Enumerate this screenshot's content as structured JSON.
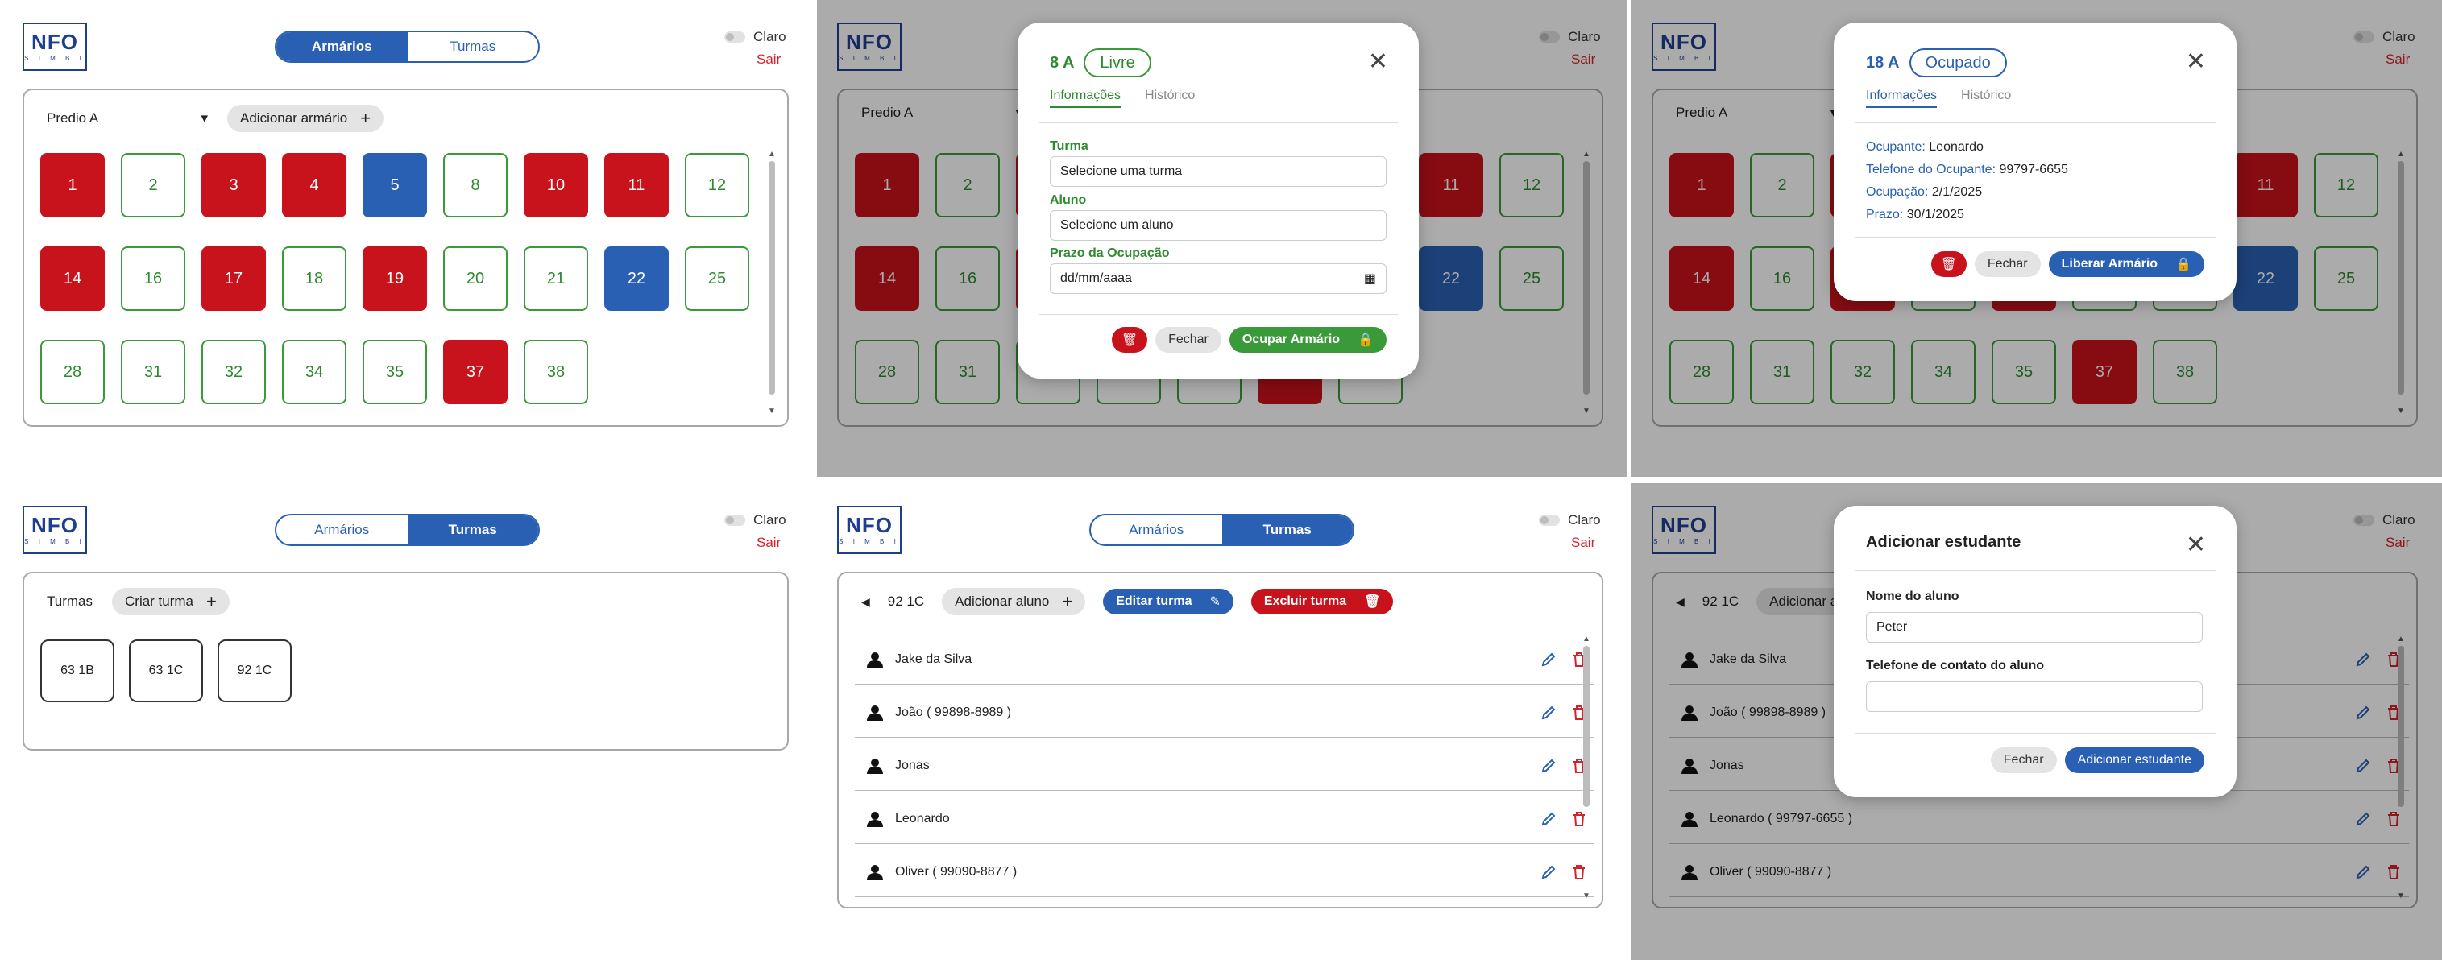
{
  "logo": {
    "letters": "NFO",
    "sub": "S I M B I"
  },
  "nav": {
    "armarios": "Armários",
    "turmas": "Turmas"
  },
  "theme": {
    "label": "Claro"
  },
  "logout": "Sair",
  "colors": {
    "primary": "#2a60b4",
    "free": "#3a9a3a",
    "occupied": "#c8121c",
    "danger": "#d2222b"
  },
  "lockers_page": {
    "building": "Predio A",
    "add_locker": "Adicionar armário",
    "lockers": [
      {
        "n": "1",
        "s": "occ"
      },
      {
        "n": "2",
        "s": "free"
      },
      {
        "n": "3",
        "s": "occ"
      },
      {
        "n": "4",
        "s": "occ"
      },
      {
        "n": "5",
        "s": "blue"
      },
      {
        "n": "8",
        "s": "free"
      },
      {
        "n": "10",
        "s": "occ"
      },
      {
        "n": "11",
        "s": "occ"
      },
      {
        "n": "12",
        "s": "free"
      },
      {
        "n": "14",
        "s": "occ"
      },
      {
        "n": "16",
        "s": "free"
      },
      {
        "n": "17",
        "s": "occ"
      },
      {
        "n": "18",
        "s": "free"
      },
      {
        "n": "19",
        "s": "occ"
      },
      {
        "n": "20",
        "s": "free"
      },
      {
        "n": "21",
        "s": "free"
      },
      {
        "n": "22",
        "s": "blue"
      },
      {
        "n": "25",
        "s": "free"
      },
      {
        "n": "28",
        "s": "free"
      },
      {
        "n": "31",
        "s": "free"
      },
      {
        "n": "32",
        "s": "free"
      },
      {
        "n": "34",
        "s": "free"
      },
      {
        "n": "35",
        "s": "free"
      },
      {
        "n": "37",
        "s": "occ"
      },
      {
        "n": "38",
        "s": "free"
      }
    ]
  },
  "free_modal": {
    "number": "8 A",
    "status": "Livre",
    "tab_info": "Informações",
    "tab_history": "Histórico",
    "turma_label": "Turma",
    "turma_value": "Selecione uma turma",
    "aluno_label": "Aluno",
    "aluno_value": "Selecione um aluno",
    "prazo_label": "Prazo da Ocupação",
    "prazo_value": "dd/mm/aaaa",
    "close": "Fechar",
    "occupy": "Ocupar Armário"
  },
  "occupied_modal": {
    "number": "18 A",
    "status": "Ocupado",
    "tab_info": "Informações",
    "tab_history": "Histórico",
    "occupant_label": "Ocupante:",
    "occupant_value": "Leonardo",
    "phone_label": "Telefone do Ocupante:",
    "phone_value": "99797-6655",
    "occupation_label": "Ocupação:",
    "occupation_value": "2/1/2025",
    "deadline_label": "Prazo:",
    "deadline_value": "30/1/2025",
    "close": "Fechar",
    "release": "Liberar Armário"
  },
  "classes_page": {
    "title": "Turmas",
    "create": "Criar turma",
    "classes": [
      "63 1B",
      "63 1C",
      "92 1C"
    ]
  },
  "class_detail": {
    "name": "92 1C",
    "add_student": "Adicionar aluno",
    "edit": "Editar turma",
    "delete": "Excluir turma",
    "students": [
      "Jake da Silva",
      "João ( 99898-8989 )",
      "Jonas",
      "Leonardo",
      "Oliver ( 99090-8877 )"
    ],
    "students_bg": [
      "Jake da Silva",
      "João ( 99898-8989 )",
      "Jonas",
      "Leonardo ( 99797-6655 )",
      "Oliver ( 99090-8877 )"
    ]
  },
  "add_student_modal": {
    "title": "Adicionar estudante",
    "name_label": "Nome do aluno",
    "name_value": "Peter",
    "phone_label": "Telefone de contato do aluno",
    "phone_value": "",
    "close": "Fechar",
    "submit": "Adicionar estudante"
  }
}
